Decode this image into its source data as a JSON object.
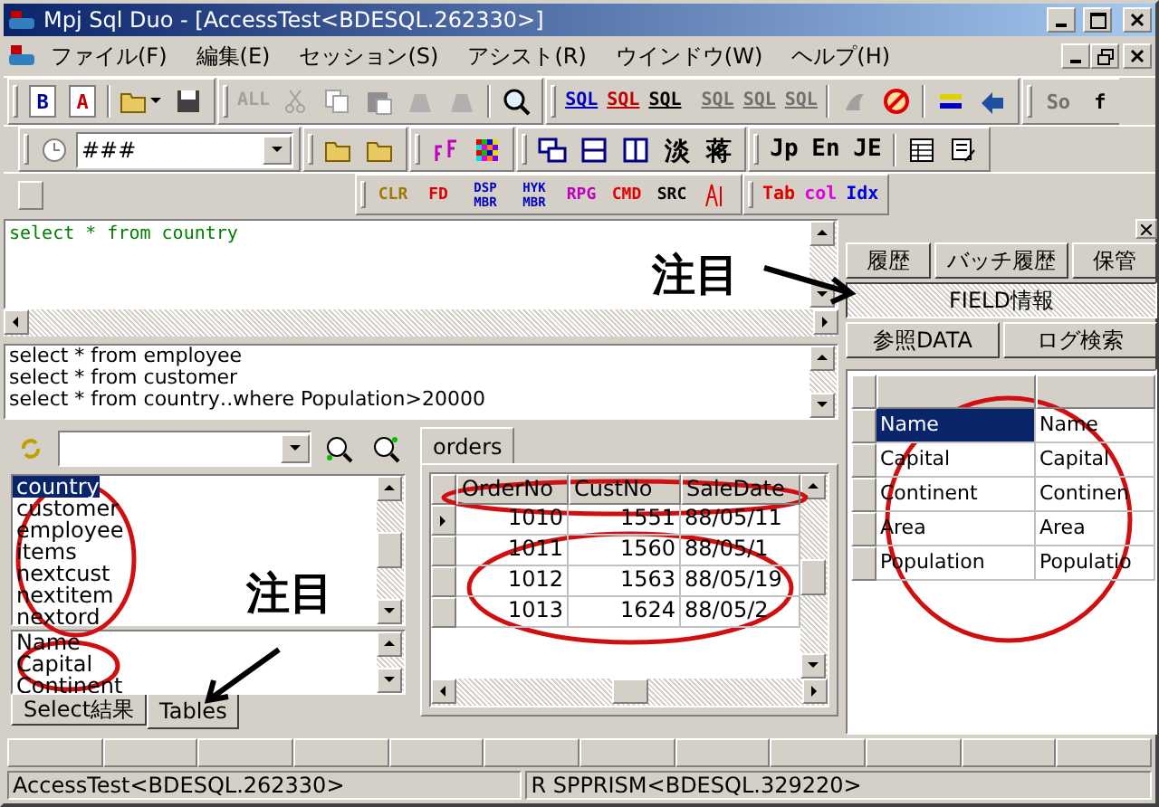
{
  "window": {
    "title": "Mpj Sql Duo - [AccessTest<BDESQL.262330>]"
  },
  "menu": [
    {
      "label": "ファイル(F)"
    },
    {
      "label": "編集(E)"
    },
    {
      "label": "セッション(S)"
    },
    {
      "label": "アシスト(R)"
    },
    {
      "label": "ウインドウ(W)"
    },
    {
      "label": "ヘルプ(H)"
    }
  ],
  "toolbar_1": {
    "doc_buttons": [
      "B",
      "A"
    ],
    "all_button": {
      "label": "ALL",
      "disabled": true
    },
    "sql_buttons": [
      {
        "label": "SQL",
        "disabled": false
      },
      {
        "label": "SQL",
        "disabled": false
      },
      {
        "label": "SQL",
        "disabled": false
      },
      {
        "label": "SQL",
        "disabled": true
      },
      {
        "label": "SQL",
        "disabled": true
      },
      {
        "label": "SQL",
        "disabled": true
      }
    ],
    "edge_buttons": [
      {
        "label": "So",
        "disabled": true
      },
      {
        "label": "f",
        "disabled": false
      }
    ]
  },
  "toolbar_2": {
    "format_combo": {
      "value": "###"
    },
    "kanji_buttons": [
      "淡",
      "蒋"
    ],
    "language_buttons": [
      "Jp",
      "En",
      "JE"
    ]
  },
  "toolbar_3": {
    "buttons": [
      {
        "label": "CLR",
        "color": "#a07800"
      },
      {
        "label": "FD",
        "color": "#e00000"
      },
      {
        "label": "DSP MBR",
        "color": "#0000c0"
      },
      {
        "label": "HYK MBR",
        "color": "#0000c0"
      },
      {
        "label": "RPG",
        "color": "#c000c0"
      },
      {
        "label": "CMD",
        "color": "#e00000"
      },
      {
        "label": "SRC",
        "color": "#000000"
      }
    ],
    "object_buttons": [
      {
        "label": "Tab",
        "color": "#e00000"
      },
      {
        "label": "col",
        "color": "#e000e0"
      },
      {
        "label": "Idx",
        "color": "#0000e0"
      }
    ]
  },
  "editor": {
    "value": "select * from country"
  },
  "history": [
    "select * from employee",
    "select * from customer",
    "select * from country‥where Population>20000"
  ],
  "tables_panel": {
    "tables": [
      {
        "name": "country",
        "selected": true
      },
      {
        "name": "customer",
        "selected": false
      },
      {
        "name": "employee",
        "selected": false
      },
      {
        "name": "items",
        "selected": false
      },
      {
        "name": "nextcust",
        "selected": false
      },
      {
        "name": "nextitem",
        "selected": false
      },
      {
        "name": "nextord",
        "selected": false
      }
    ],
    "fields": [
      "Name",
      "Capital",
      "Continent"
    ],
    "tabs": [
      {
        "label": "Select結果",
        "selected": false
      },
      {
        "label": "Tables",
        "selected": true
      }
    ]
  },
  "grid_panel": {
    "tab": "orders",
    "columns": [
      "OrderNo",
      "CustNo",
      "SaleDate"
    ],
    "rows": [
      {
        "cells": [
          "1010",
          "1551",
          "88/05/11"
        ],
        "current": true
      },
      {
        "cells": [
          "1011",
          "1560",
          "88/05/1"
        ],
        "current": false
      },
      {
        "cells": [
          "1012",
          "1563",
          "88/05/19"
        ],
        "current": false
      },
      {
        "cells": [
          "1013",
          "1624",
          "88/05/2"
        ],
        "current": false
      }
    ]
  },
  "right_panel": {
    "top_buttons": [
      "履歴",
      "バッチ履歴",
      "保管"
    ],
    "field_info": {
      "label": "FIELD情報",
      "selected": true
    },
    "bottom_buttons": [
      "参照DATA",
      "ログ検索"
    ],
    "rows": [
      {
        "cells": [
          "Name",
          "Name"
        ],
        "selected": true
      },
      {
        "cells": [
          "Capital",
          "Capital"
        ],
        "selected": false
      },
      {
        "cells": [
          "Continent",
          "Continen"
        ],
        "selected": false
      },
      {
        "cells": [
          "Area",
          "Area"
        ],
        "selected": false
      },
      {
        "cells": [
          "Population",
          "Populatio"
        ],
        "selected": false
      }
    ]
  },
  "status_bar": [
    "AccessTest<BDESQL.262330>",
    "R SPPRISM<BDESQL.329220>"
  ],
  "annotations": [
    "注目",
    "注目"
  ]
}
